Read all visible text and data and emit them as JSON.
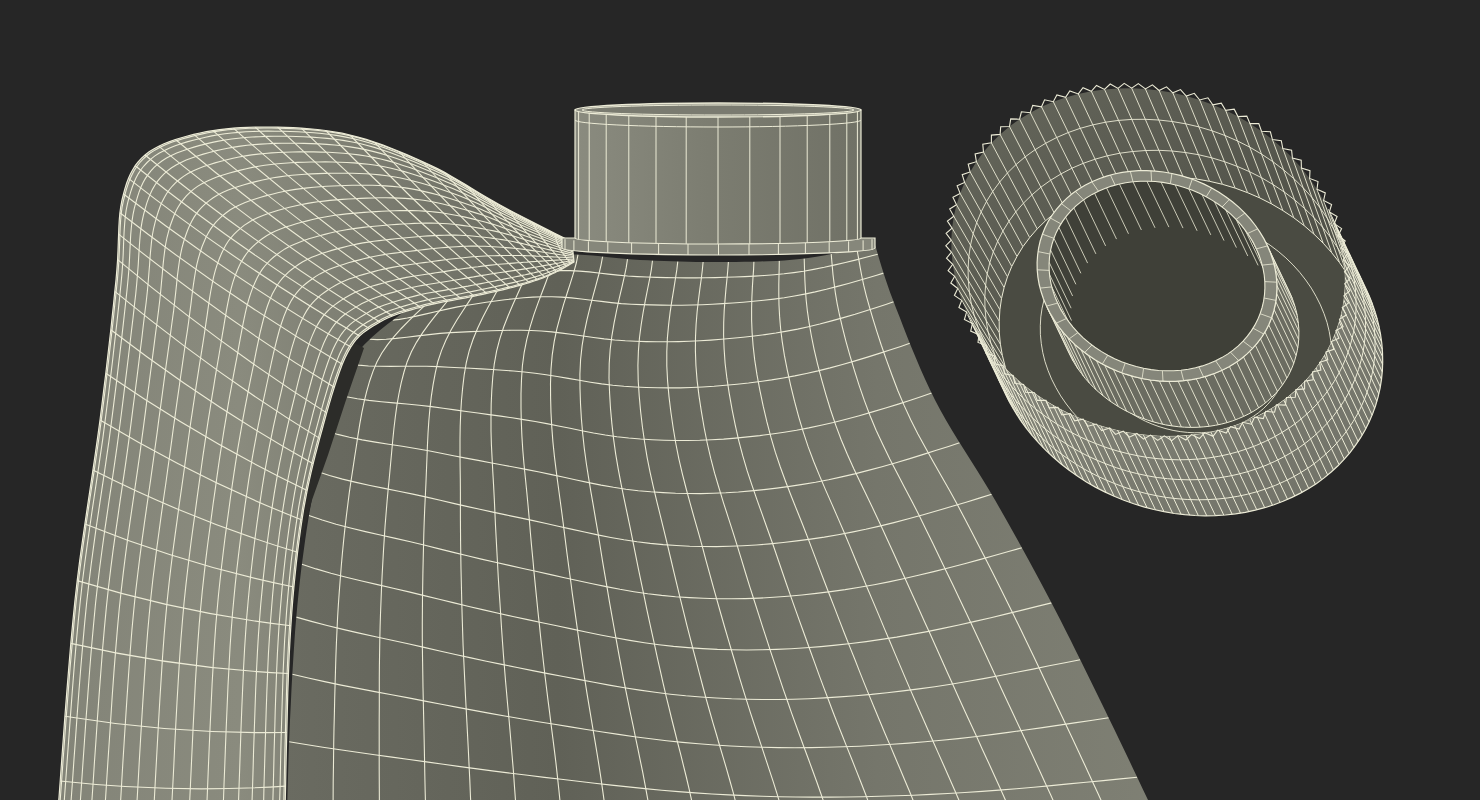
{
  "scene": {
    "objects": [
      {
        "kind": "bottle"
      },
      {
        "kind": "cap"
      }
    ]
  }
}
